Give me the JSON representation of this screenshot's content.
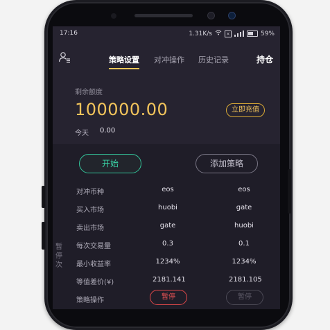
{
  "status_bar": {
    "time": "17:16",
    "network_speed": "1.31K/s",
    "battery": "59%"
  },
  "nav": {
    "tabs": [
      {
        "label": "策略设置",
        "active": true
      },
      {
        "label": "对冲操作",
        "active": false
      },
      {
        "label": "历史记录",
        "active": false
      }
    ],
    "right_label": "持仓"
  },
  "balance": {
    "label": "剩余额度",
    "value": "100000.00",
    "recharge_label": "立即充值",
    "today_label": "今天",
    "today_value": "0.00"
  },
  "actions": {
    "start_label": "开始",
    "add_label": "添加策略"
  },
  "side_label": "暂停次",
  "strategy_table": {
    "rows": [
      {
        "label": "对冲币种",
        "values": [
          "eos",
          "eos"
        ]
      },
      {
        "label": "买入市场",
        "values": [
          "huobi",
          "gate"
        ]
      },
      {
        "label": "卖出市场",
        "values": [
          "gate",
          "huobi"
        ]
      },
      {
        "label": "每次交易量",
        "values": [
          "0.3",
          "0.1"
        ]
      },
      {
        "label": "最小收益率",
        "values": [
          "1234%",
          "1234%"
        ]
      },
      {
        "label": "等值差价(¥)",
        "values": [
          "2181.141",
          "2181.105"
        ]
      },
      {
        "label": "策略操作",
        "values": [
          "暂停",
          "暂停"
        ]
      }
    ]
  },
  "colors": {
    "accent_gold": "#f2c45b",
    "start_green": "#3ad3a5",
    "pause_red": "#ef5456",
    "screen_bg": "#262330"
  }
}
